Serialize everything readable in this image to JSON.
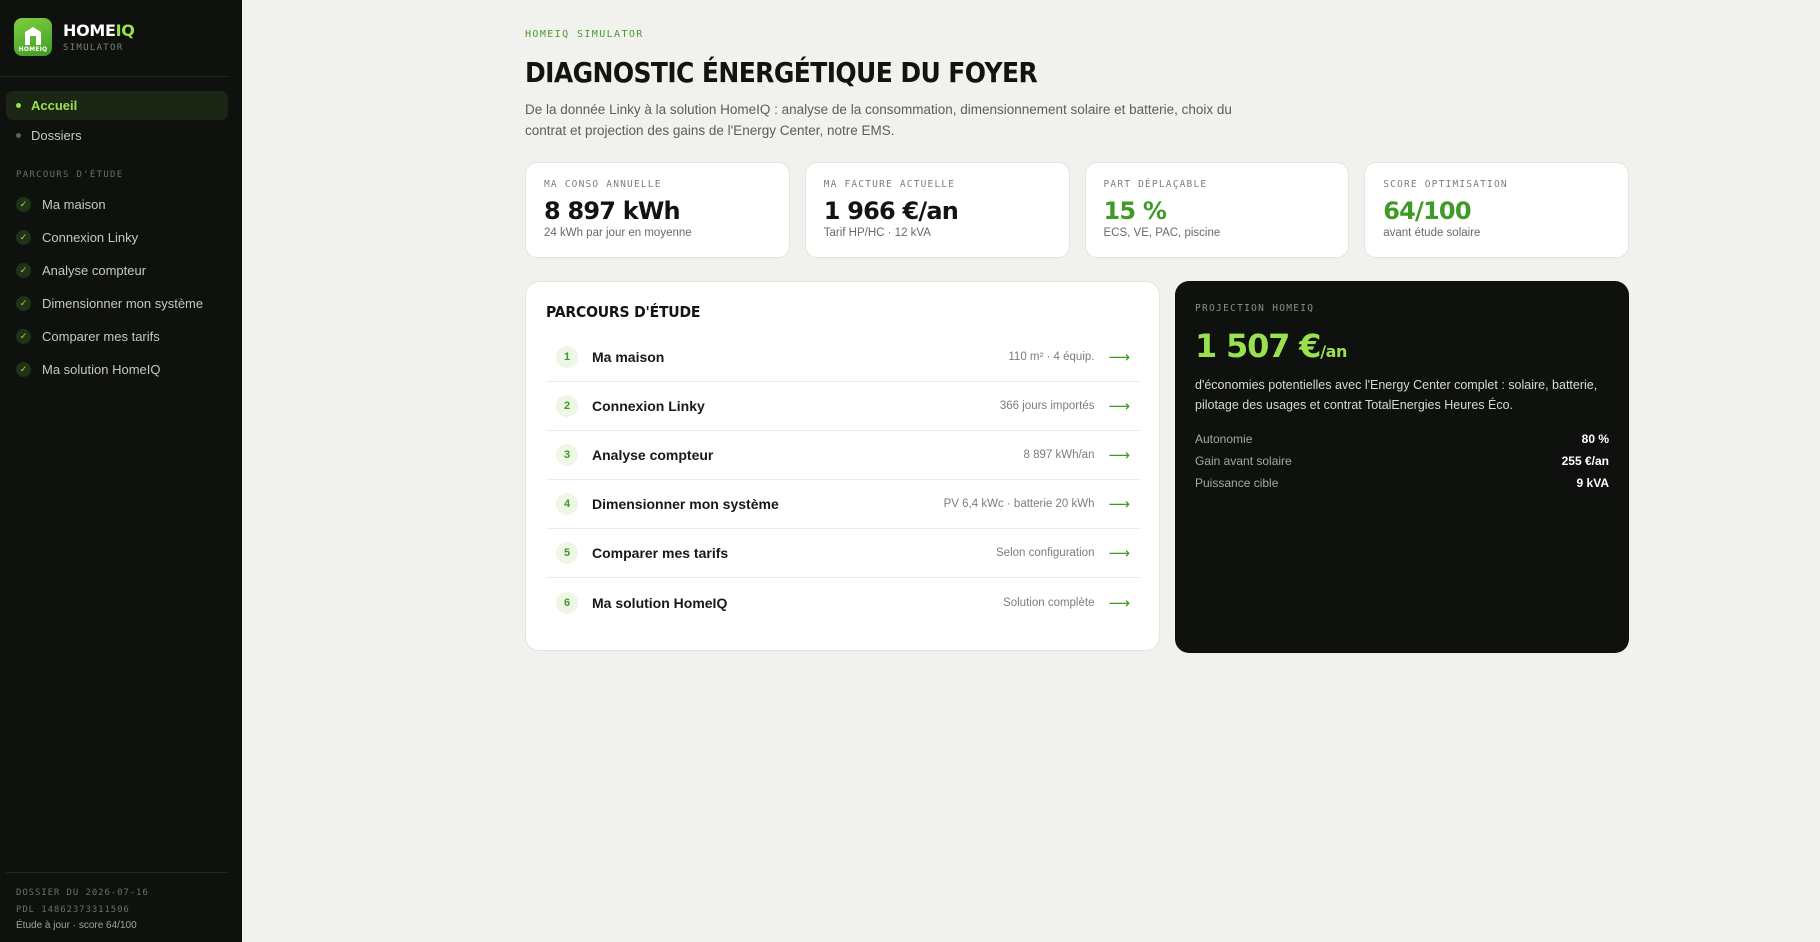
{
  "brand": {
    "name_main": "HOME",
    "name_accent": "IQ",
    "logo_text": "HOMEIQ",
    "subtitle": "SIMULATOR"
  },
  "nav": {
    "items": [
      {
        "label": "Accueil",
        "active": true
      },
      {
        "label": "Dossiers",
        "active": false
      }
    ]
  },
  "sidebar_steps": {
    "title": "PARCOURS D'ÉTUDE",
    "items": [
      {
        "label": "Ma maison"
      },
      {
        "label": "Connexion Linky"
      },
      {
        "label": "Analyse compteur"
      },
      {
        "label": "Dimensionner mon système"
      },
      {
        "label": "Comparer mes tarifs"
      },
      {
        "label": "Ma solution HomeIQ"
      }
    ]
  },
  "sidebar_footer": {
    "date": "DOSSIER DU 2026-07-16",
    "pdl": "PDL 14862373311506",
    "status": "Étude à jour · score 64/100"
  },
  "header": {
    "eyebrow": "HOMEIQ SIMULATOR",
    "title": "DIAGNOSTIC ÉNERGÉTIQUE DU FOYER",
    "intro": "De la donnée Linky à la solution HomeIQ : analyse de la consommation, dimensionnement solaire et batterie, choix du contrat et projection des gains de l'Energy Center, notre EMS."
  },
  "kpis": [
    {
      "label": "MA CONSO ANNUELLE",
      "value": "8 897 kWh",
      "sub": "24 kWh par jour en moyenne",
      "accent": false
    },
    {
      "label": "MA FACTURE ACTUELLE",
      "value": "1 966 €/an",
      "sub": "Tarif HP/HC · 12 kVA",
      "accent": false
    },
    {
      "label": "PART DÉPLAÇABLE",
      "value": "15 %",
      "sub": "ECS, VE, PAC, piscine",
      "accent": true
    },
    {
      "label": "SCORE OPTIMISATION",
      "value": "64/100",
      "sub": "avant étude solaire",
      "accent": true
    }
  ],
  "journey": {
    "title": "PARCOURS D'ÉTUDE",
    "steps": [
      {
        "num": "1",
        "label": "Ma maison",
        "meta": "110 m² · 4 équip."
      },
      {
        "num": "2",
        "label": "Connexion Linky",
        "meta": "366 jours importés"
      },
      {
        "num": "3",
        "label": "Analyse compteur",
        "meta": "8 897 kWh/an"
      },
      {
        "num": "4",
        "label": "Dimensionner mon système",
        "meta": "PV 6,4 kWc · batterie 20 kWh"
      },
      {
        "num": "5",
        "label": "Comparer mes tarifs",
        "meta": "Selon configuration"
      },
      {
        "num": "6",
        "label": "Ma solution HomeIQ",
        "meta": "Solution complète"
      }
    ],
    "arrow": "⟶"
  },
  "projection": {
    "eyebrow": "PROJECTION HOMEIQ",
    "value": "1 507 €",
    "unit": "/an",
    "description": "d'économies potentielles avec l'Energy Center complet : solaire, batterie, pilotage des usages et contrat TotalEnergies Heures Éco.",
    "stats": [
      {
        "label": "Autonomie",
        "value": "80 %"
      },
      {
        "label": "Gain avant solaire",
        "value": "255 €/an"
      },
      {
        "label": "Puissance cible",
        "value": "9 kVA"
      }
    ]
  },
  "colors": {
    "accent": "#9be14f",
    "accent_dark": "#3f9a26",
    "sidebar_bg": "#0f110e",
    "page_bg": "#f1f2ee"
  }
}
